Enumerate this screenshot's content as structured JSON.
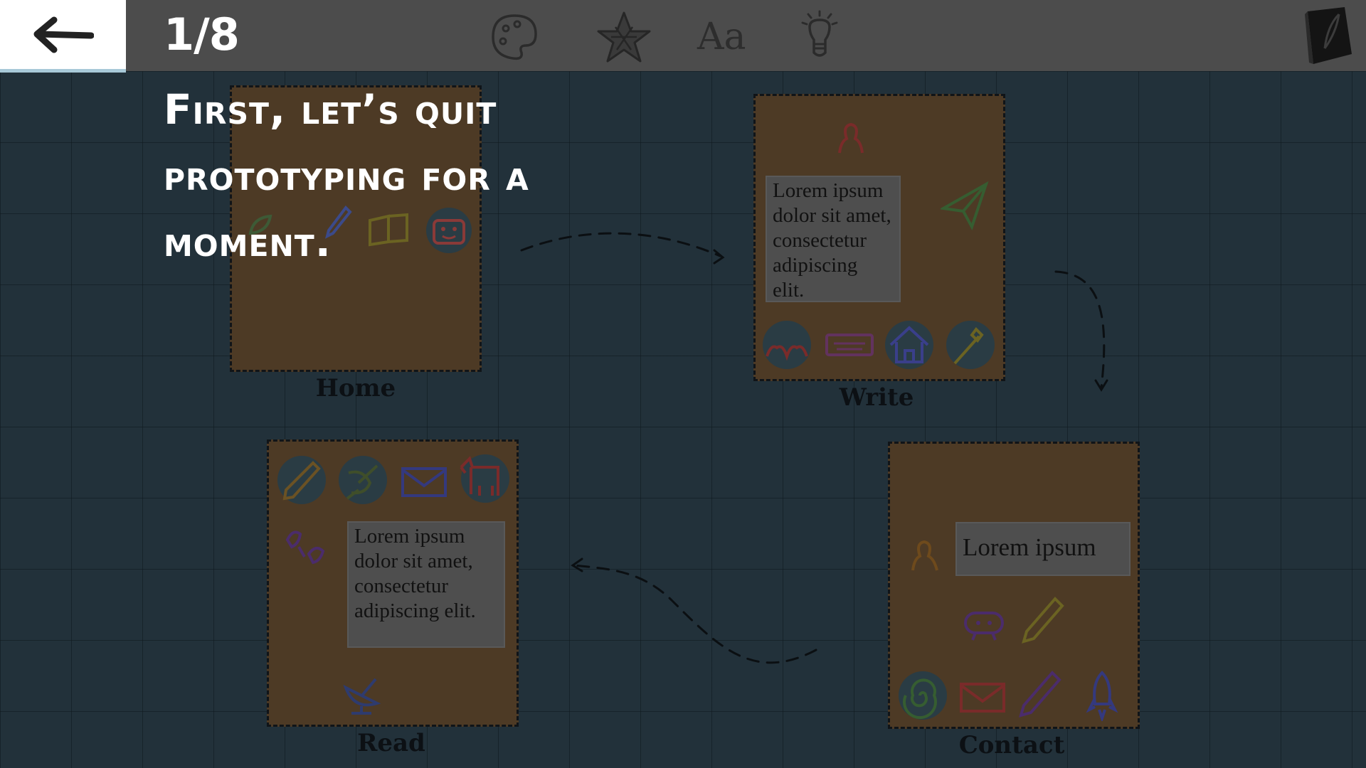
{
  "topbar": {
    "step_counter": "1/8",
    "back_icon": "arrow-left-icon",
    "tools": [
      {
        "name": "palette-icon"
      },
      {
        "name": "star-icon"
      },
      {
        "name": "font-icon",
        "glyph": "Aa"
      },
      {
        "name": "lightbulb-icon"
      }
    ],
    "notebook_icon": "notebook-icon"
  },
  "tutorial": {
    "text": "First, let’s quit prototyping for a moment."
  },
  "frames": {
    "home": {
      "label": "Home"
    },
    "write": {
      "label": "Write",
      "lorem": "Lorem ipsum dolor sit amet, consectetur adipiscing elit."
    },
    "read": {
      "label": "Read",
      "lorem": "Lorem ipsum dolor sit amet, consectetur adipiscing elit."
    },
    "contact": {
      "label": "Contact",
      "lorem": "Lorem ipsum"
    }
  },
  "colors": {
    "topbar": "#4c4c4c",
    "canvas": "#22313a",
    "frame_fill": "#4d3a25",
    "accent_underline": "#a8c9d8"
  }
}
